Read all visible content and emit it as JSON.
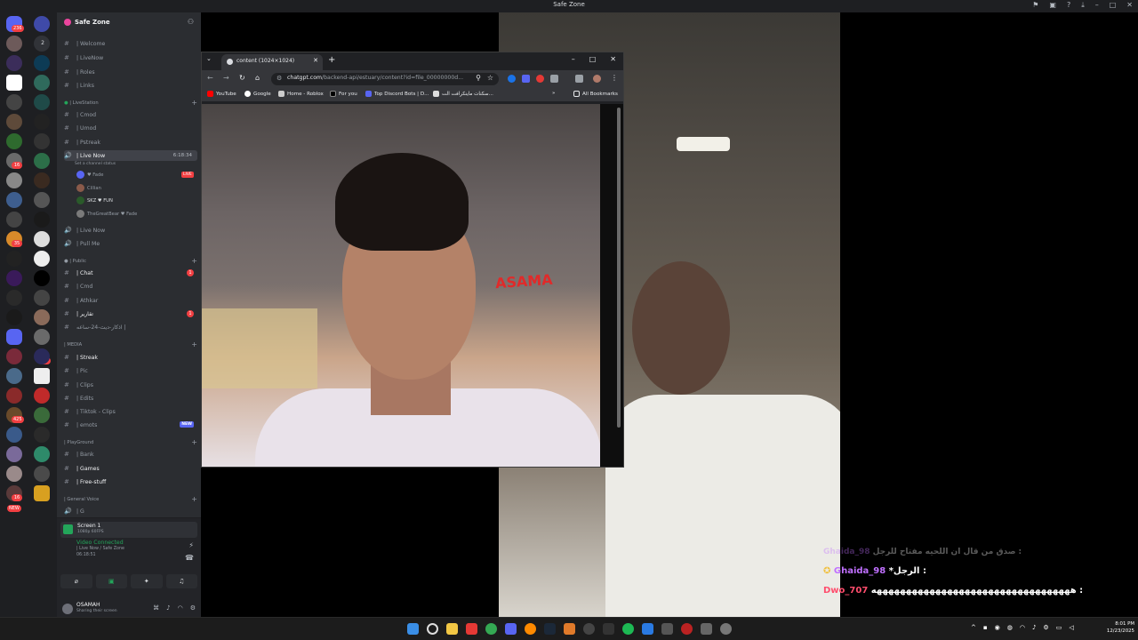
{
  "app": {
    "window_title": "Safe Zone"
  },
  "server": {
    "name": "Safe Zone"
  },
  "rail_badges": [
    "236",
    "2",
    "16",
    "35",
    "12",
    "425",
    "16",
    "NEW"
  ],
  "channels": {
    "top": [
      {
        "label": "| Welcome"
      },
      {
        "label": "| LiveNow"
      },
      {
        "label": "| Roles"
      },
      {
        "label": "| Links"
      }
    ],
    "cat_livestation": "| LiveStation",
    "livestation": [
      {
        "label": "| Cmod"
      },
      {
        "label": "| Umod"
      },
      {
        "label": "| Pstreak"
      }
    ],
    "live_now": {
      "label": "| Live Now",
      "time": "6:18:34",
      "status": "Set a channel status"
    },
    "voice_users": [
      {
        "name": "♥ Fade",
        "tag": "LIVE"
      },
      {
        "name": "Cillian",
        "tag": ""
      },
      {
        "name": "SKZ ♥ FUN",
        "tag": ""
      },
      {
        "name": "TheGreatBear ♥ Fade",
        "tag": ""
      }
    ],
    "after_voice": [
      {
        "label": "| Live Now"
      },
      {
        "label": "| Pull Me"
      }
    ],
    "cat_public": "| Public",
    "public": [
      {
        "label": "| Chat",
        "badge": "1"
      },
      {
        "label": "| Cmd",
        "badge": ""
      },
      {
        "label": "| Athkar",
        "badge": ""
      },
      {
        "label": "| تقارير",
        "badge": "1"
      },
      {
        "label": "اذكار-ديث-24-ساعه |",
        "badge": ""
      }
    ],
    "cat_media": "| MEDIA",
    "media": [
      {
        "label": "| Streak",
        "tag": ""
      },
      {
        "label": "| Pic",
        "tag": ""
      },
      {
        "label": "| Clips",
        "tag": ""
      },
      {
        "label": "| Edits",
        "tag": ""
      },
      {
        "label": "| Tiktok - Clips",
        "tag": ""
      },
      {
        "label": "| emots",
        "tag": "NEW"
      }
    ],
    "cat_playground": "| PlayGround",
    "playground": [
      {
        "label": "| Bank"
      },
      {
        "label": "| Games"
      },
      {
        "label": "| Free-stuff"
      }
    ],
    "cat_general_voice": "| General Voice",
    "general_voice": [
      {
        "label": "| G"
      }
    ]
  },
  "voice_panel": {
    "screen_title": "Screen 1",
    "screen_sub": "1080p 60FPS",
    "status": "Video Connected",
    "location": "| Live Now / Safe Zone",
    "elapsed": "06:18:51"
  },
  "user": {
    "name": "OSAMAH",
    "status": "Sharing their screen"
  },
  "browser": {
    "tab_title": "content (1024×1024)",
    "url_host": "chatgpt.com",
    "url_path": "/backend-api/estuary/content?id=file_00000000d...",
    "bookmarks": [
      "YouTube",
      "Google",
      "Home - Roblox",
      "For you",
      "Top Discord Bots | D...",
      "سكنات ماينكرافت الت..."
    ],
    "all_bookmarks": "All Bookmarks",
    "sign_text": "ASAMA"
  },
  "chat": [
    {
      "user": "Ghaida_98",
      "text": "صدق من قال ان اللحيه مفتاح للرجل :",
      "faded": true,
      "color": "#c070ff"
    },
    {
      "user": "Ghaida_98",
      "text": "*الرجل :",
      "faded": false,
      "color": "#c070ff"
    },
    {
      "user": "Dwo_707",
      "text": "ههههههههههههههههههههههههههههههههههه :",
      "faded": false,
      "color": "#ff4d6d"
    }
  ],
  "taskbar": {
    "time": "8:01 PM",
    "date": "12/23/2025"
  },
  "colors": {
    "discord_bg": "#2b2d31",
    "rail_bg": "#1e1f22",
    "accent_green": "#23a55a",
    "badge_red": "#f23f42"
  }
}
